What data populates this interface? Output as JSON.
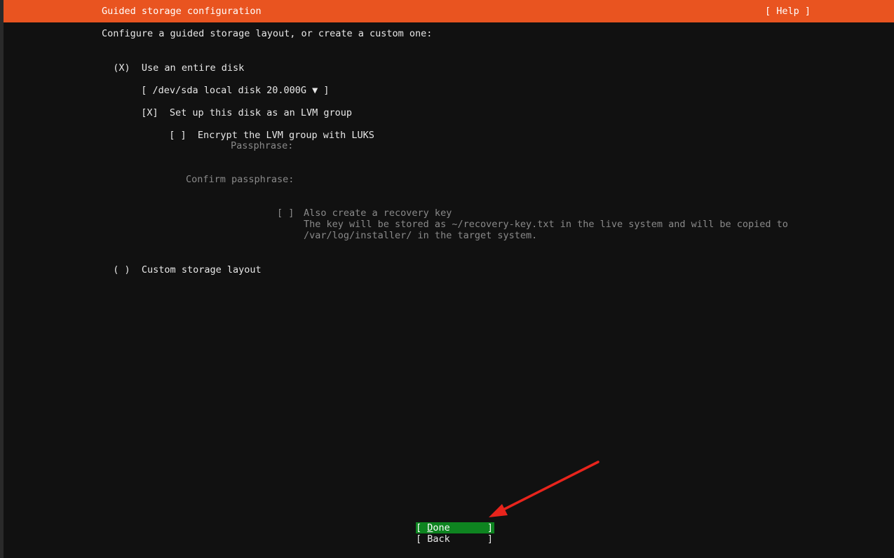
{
  "header": {
    "title": "Guided storage configuration",
    "help_label": "[ Help ]"
  },
  "intro": "Configure a guided storage layout, or create a custom one:",
  "entire_disk": {
    "radio": "(X)",
    "label": "Use an entire disk"
  },
  "disk_select": {
    "open": "[",
    "value": "/dev/sda local disk 20.000G",
    "caret": "▼",
    "close": "]"
  },
  "lvm": {
    "checkbox": "[X]",
    "label": "Set up this disk as an LVM group"
  },
  "luks": {
    "checkbox": "[ ]",
    "label": "Encrypt the LVM group with LUKS"
  },
  "passphrase": {
    "label": "Passphrase:",
    "value": ""
  },
  "confirm_passphrase": {
    "label": "Confirm passphrase:",
    "value": ""
  },
  "recovery": {
    "checkbox": "[ ]",
    "label": "Also create a recovery key",
    "desc_line1": "The key will be stored as ~/recovery-key.txt in the live system and will be copied to",
    "desc_line2": "/var/log/installer/ in the target system."
  },
  "custom_layout": {
    "radio": "( )",
    "label": "Custom storage layout"
  },
  "buttons": {
    "done_open": "[ ",
    "done_hotkey": "D",
    "done_rest": "one",
    "done_close": "]",
    "back_open": "[ ",
    "back_label": "Back",
    "back_close": "]"
  },
  "colors": {
    "header_bg": "#e95420",
    "background": "#111111",
    "done_bg": "#0e8420",
    "arrow": "#e8241c"
  }
}
